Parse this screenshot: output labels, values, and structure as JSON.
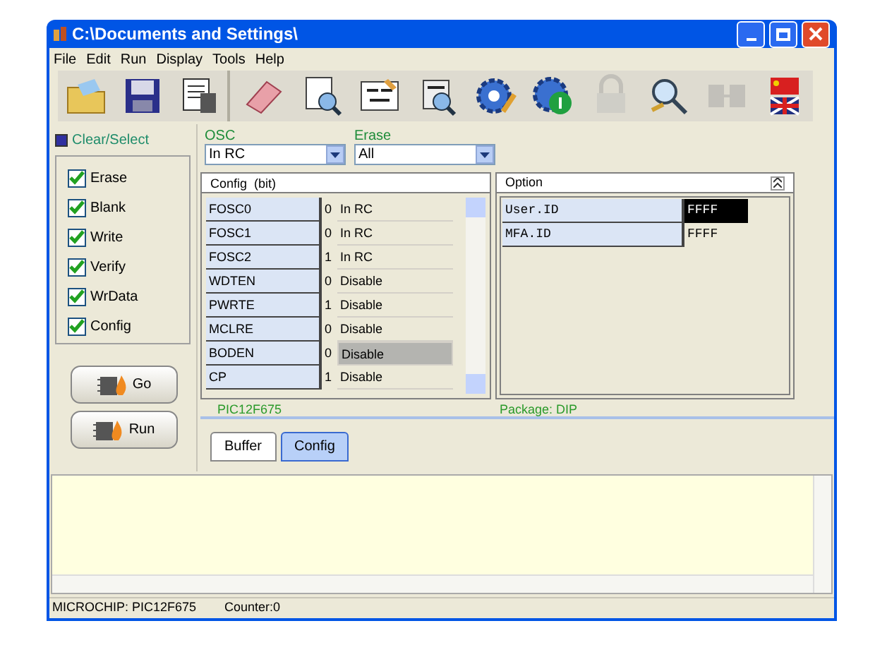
{
  "window": {
    "title": "C:\\Documents and Settings\\"
  },
  "menu": [
    "File",
    "Edit",
    "Run",
    "Display",
    "Tools",
    "Help"
  ],
  "toolbar": [
    {
      "disabled": false
    },
    {
      "disabled": false
    },
    {
      "disabled": false
    },
    {
      "disabled": false
    },
    {
      "disabled": false
    },
    {
      "disabled": false
    },
    {
      "disabled": false
    },
    {
      "disabled": false
    },
    {
      "disabled": false
    },
    {
      "disabled": true
    },
    {
      "disabled": false
    },
    {
      "disabled": true
    },
    {
      "disabled": false
    }
  ],
  "clear_select": {
    "label": "Clear/Select"
  },
  "operations": [
    {
      "label": "Erase",
      "checked": true
    },
    {
      "label": "Blank",
      "checked": true
    },
    {
      "label": "Write",
      "checked": true
    },
    {
      "label": "Verify",
      "checked": true
    },
    {
      "label": "WrData",
      "checked": true
    },
    {
      "label": "Config",
      "checked": true
    }
  ],
  "actions": [
    "Go",
    "Run"
  ],
  "osc": {
    "label": "OSC",
    "value": "In RC"
  },
  "erase": {
    "label": "Erase",
    "value": "All"
  },
  "config": {
    "header": "Config  (bit)",
    "rows": [
      {
        "name": "FOSC0",
        "bit": "0",
        "value": "In RC",
        "selected": false
      },
      {
        "name": "FOSC1",
        "bit": "0",
        "value": "In RC",
        "selected": false
      },
      {
        "name": "FOSC2",
        "bit": "1",
        "value": "In RC",
        "selected": false
      },
      {
        "name": "WDTEN",
        "bit": "0",
        "value": "Disable",
        "selected": false
      },
      {
        "name": "PWRTE",
        "bit": "1",
        "value": "Disable",
        "selected": false
      },
      {
        "name": "MCLRE",
        "bit": "0",
        "value": "Disable",
        "selected": false
      },
      {
        "name": "BODEN",
        "bit": "0",
        "value": "Disable",
        "selected": true
      },
      {
        "name": "CP",
        "bit": "1",
        "value": "Disable",
        "selected": false
      }
    ]
  },
  "option": {
    "header": "Option",
    "rows": [
      {
        "name": "User.ID",
        "value": "FFFF",
        "selected": true
      },
      {
        "name": "MFA.ID",
        "value": "FFFF",
        "selected": false
      }
    ]
  },
  "device": "PIC12F675",
  "package": "Package: DIP",
  "tabs": [
    {
      "label": "Buffer",
      "selected": false
    },
    {
      "label": "Config",
      "selected": true
    }
  ],
  "status_bar": [
    "MICROCHIP: PIC12F675",
    "Counter:0"
  ]
}
